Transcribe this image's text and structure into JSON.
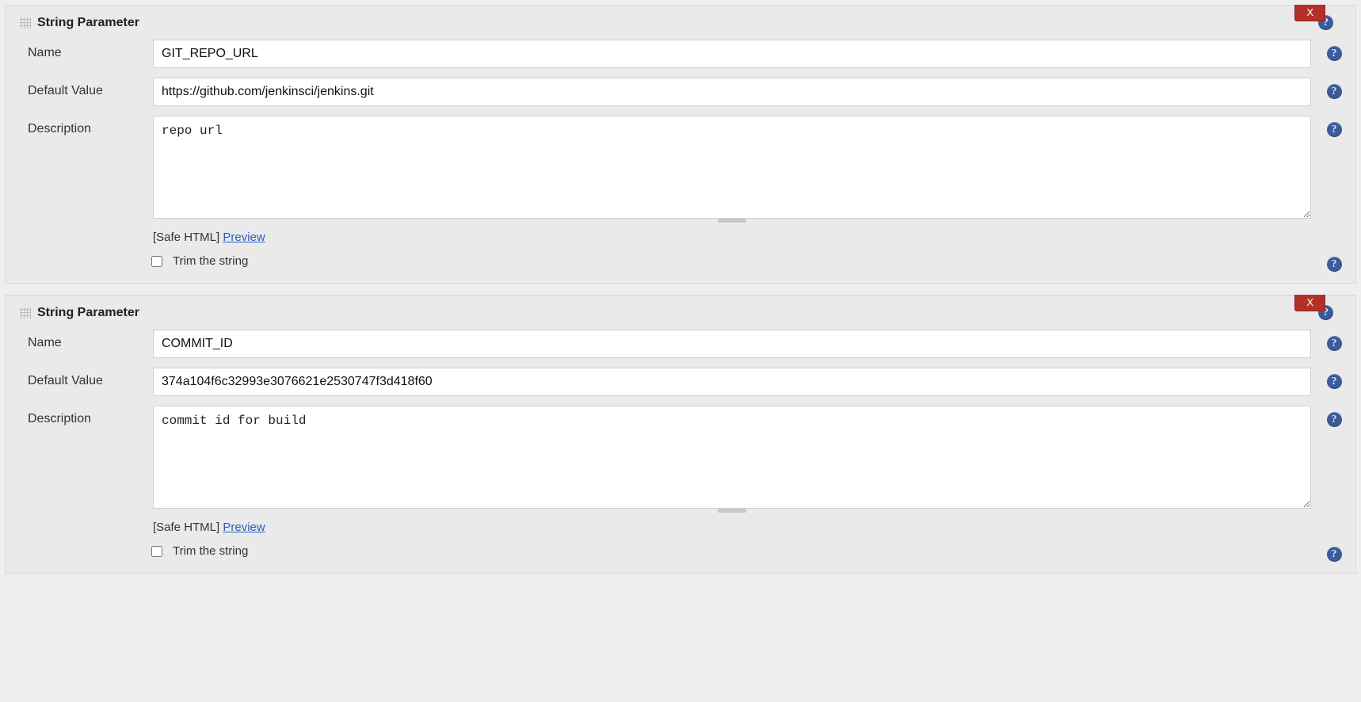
{
  "common": {
    "title": "String Parameter",
    "labels": {
      "name": "Name",
      "default_value": "Default Value",
      "description": "Description",
      "safe_html": "[Safe HTML]",
      "preview": "Preview",
      "trim": "Trim the string",
      "delete": "X"
    }
  },
  "params": [
    {
      "name": "GIT_REPO_URL",
      "default_value": "https://github.com/jenkinsci/jenkins.git",
      "description": "repo url",
      "trim": false
    },
    {
      "name": "COMMIT_ID",
      "default_value": "374a104f6c32993e3076621e2530747f3d418f60",
      "description": "commit id for build",
      "trim": false
    }
  ]
}
